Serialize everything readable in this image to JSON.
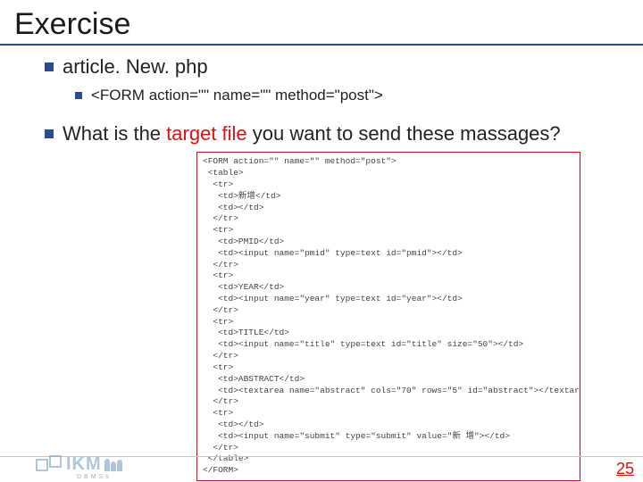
{
  "title": "Exercise",
  "bullets": {
    "b1a": "article. New. php",
    "b1a_sub": "<FORM action=\"\" name=\"\" method=\"post\">",
    "b2_pre": "What is the ",
    "b2_red": "target file",
    "b2_post": " you want to send these massages?"
  },
  "code": "<FORM action=\"\" name=\"\" method=\"post\">\n <table>\n  <tr>\n   <td>新增</td>\n   <td></td>\n  </tr>\n  <tr>\n   <td>PMID</td>\n   <td><input name=\"pmid\" type=text id=\"pmid\"></td>\n  </tr>\n  <tr>\n   <td>YEAR</td>\n   <td><input name=\"year\" type=text id=\"year\"></td>\n  </tr>\n  <tr>\n   <td>TITLE</td>\n   <td><input name=\"title\" type=text id=\"title\" size=\"50\"></td>\n  </tr>\n  <tr>\n   <td>ABSTRACT</td>\n   <td><textarea name=\"abstract\" cols=\"70\" rows=\"5\" id=\"abstract\"></textarea></td>\n  </tr>\n  <tr>\n   <td></td>\n   <td><input name=\"submit\" type=\"submit\" value=\"新 增\"></td>\n  </tr>\n </table>\n</FORM>",
  "footer": {
    "brand": "IKM",
    "sub": "DBMSs"
  },
  "page": "25"
}
